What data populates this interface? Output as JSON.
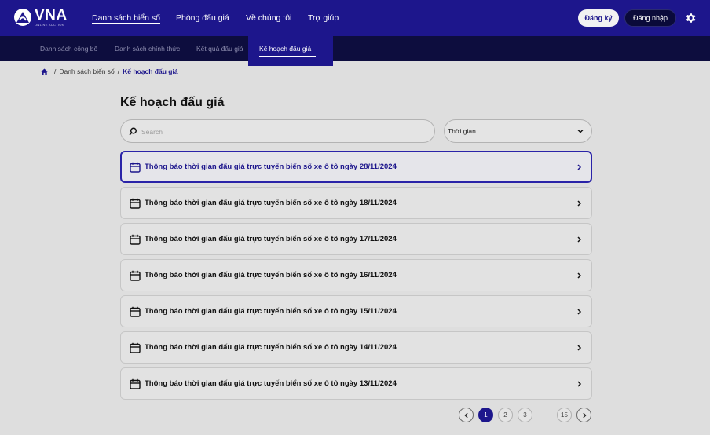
{
  "header": {
    "logo_text": "VNA",
    "logo_sub": "ONLINE AUCTION",
    "nav": [
      {
        "label": "Danh sách biển số",
        "active": true
      },
      {
        "label": "Phòng đấu giá",
        "active": false
      },
      {
        "label": "Về chúng tôi",
        "active": false
      },
      {
        "label": "Trợ giúp",
        "active": false
      }
    ],
    "register_label": "Đăng ký",
    "login_label": "Đăng nhập",
    "settings_icon": "gear-icon"
  },
  "subnav": {
    "items": [
      {
        "label": "Danh sách công bố",
        "active": false
      },
      {
        "label": "Danh sách chính thức",
        "active": false
      },
      {
        "label": "Kết quả đấu giá",
        "active": false
      },
      {
        "label": "Kế hoạch đấu giá",
        "active": true
      }
    ]
  },
  "breadcrumb": {
    "items": [
      "Danh sách biển số",
      "Kế hoạch đấu giá"
    ],
    "separator": "/"
  },
  "page": {
    "title": "Kế hoạch đấu giá",
    "search_placeholder": "Search",
    "search_value": "",
    "filter_label": "Thời gian"
  },
  "items": [
    {
      "text": "Thông báo thời gian đấu giá trực tuyến biển số xe ô tô ngày 28/11/2024",
      "highlighted": true
    },
    {
      "text": "Thông báo thời gian đấu giá trực tuyến biển số xe ô tô ngày 18/11/2024",
      "highlighted": false
    },
    {
      "text": "Thông báo thời gian đấu giá trực tuyến biển số xe ô tô ngày 17/11/2024",
      "highlighted": false
    },
    {
      "text": "Thông báo thời gian đấu giá trực tuyến biển số xe ô tô ngày 16/11/2024",
      "highlighted": false
    },
    {
      "text": "Thông báo thời gian đấu giá trực tuyến biển số xe ô tô ngày 15/11/2024",
      "highlighted": false
    },
    {
      "text": "Thông báo thời gian đấu giá trực tuyến biển số xe ô tô ngày 14/11/2024",
      "highlighted": false
    },
    {
      "text": "Thông báo thời gian đấu giá trực tuyến biển số xe ô tô ngày 13/11/2024",
      "highlighted": false
    }
  ],
  "pagination": {
    "pages": [
      "1",
      "2",
      "3"
    ],
    "ellipsis": "...",
    "last": "15",
    "current": "1"
  },
  "colors": {
    "brand": "#1d168c",
    "subnav_bg": "#0d0d3e",
    "page_bg": "#dedede"
  }
}
